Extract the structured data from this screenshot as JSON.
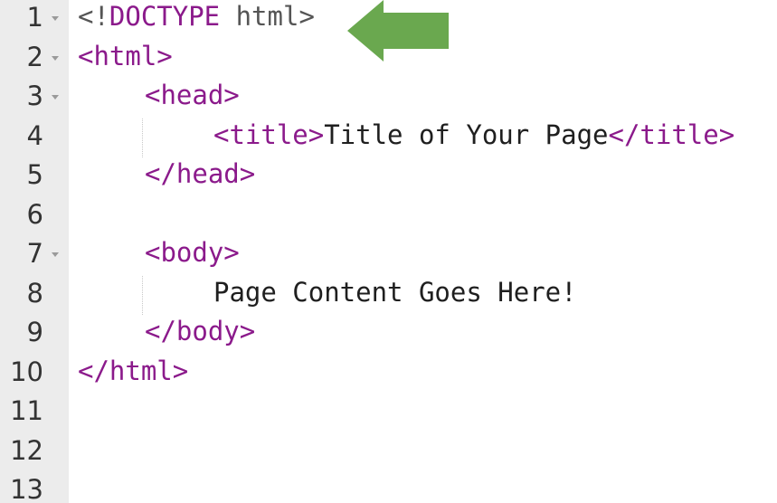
{
  "editor": {
    "lines": [
      {
        "num": "1",
        "foldable": true,
        "indent": 0,
        "segments": [
          {
            "type": "dt",
            "text": "<!"
          },
          {
            "type": "tag",
            "text": "DOCTYPE"
          },
          {
            "type": "dt",
            "text": " html>"
          }
        ]
      },
      {
        "num": "2",
        "foldable": true,
        "indent": 0,
        "segments": [
          {
            "type": "tag",
            "text": "<html>"
          }
        ]
      },
      {
        "num": "3",
        "foldable": true,
        "indent": 1,
        "segments": [
          {
            "type": "tag",
            "text": "<head>"
          }
        ]
      },
      {
        "num": "4",
        "foldable": false,
        "indent": 2,
        "guide": true,
        "segments": [
          {
            "type": "tag",
            "text": "<title>"
          },
          {
            "type": "txt",
            "text": "Title of Your Page"
          },
          {
            "type": "tag",
            "text": "</title>"
          }
        ]
      },
      {
        "num": "5",
        "foldable": false,
        "indent": 1,
        "segments": [
          {
            "type": "tag",
            "text": "</head>"
          }
        ]
      },
      {
        "num": "6",
        "foldable": false,
        "indent": 0,
        "segments": []
      },
      {
        "num": "7",
        "foldable": true,
        "indent": 1,
        "segments": [
          {
            "type": "tag",
            "text": "<body>"
          }
        ]
      },
      {
        "num": "8",
        "foldable": false,
        "indent": 2,
        "guide": true,
        "segments": [
          {
            "type": "txt",
            "text": "Page Content Goes Here!"
          }
        ]
      },
      {
        "num": "9",
        "foldable": false,
        "indent": 1,
        "segments": [
          {
            "type": "tag",
            "text": "</body>"
          }
        ]
      },
      {
        "num": "10",
        "foldable": false,
        "indent": 0,
        "segments": [
          {
            "type": "tag",
            "text": "</html>"
          }
        ]
      },
      {
        "num": "11",
        "foldable": false,
        "indent": 0,
        "segments": []
      },
      {
        "num": "12",
        "foldable": false,
        "indent": 0,
        "segments": []
      },
      {
        "num": "13",
        "foldable": false,
        "indent": 0,
        "segments": []
      }
    ]
  },
  "annotation": {
    "icon": "left-arrow-icon",
    "color": "#6aa84f",
    "points_to_line": "1"
  },
  "colors": {
    "tag": "#8b1a8b",
    "doctype": "#555555",
    "text": "#1f1f1f",
    "gutter": "#ececec"
  }
}
